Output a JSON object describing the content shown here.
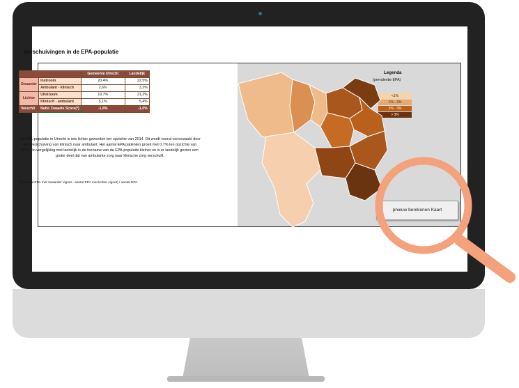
{
  "table": {
    "header_col1": "Gemeente Utrecht",
    "header_col2": "Landelijk",
    "groups": [
      {
        "label": "Zwaarder",
        "rows": [
          {
            "label": "Instroom",
            "v1": "20,4%",
            "v2": "22,5%"
          },
          {
            "label": "Ambulant   - klinisch",
            "v1": "2,6%",
            "v2": "3,2%"
          }
        ]
      },
      {
        "label": "Lichter",
        "rows": [
          {
            "label": "Uitstroom",
            "v1": "19,7%",
            "v2": "21,2%"
          },
          {
            "label": "Klinisch   - ambulant",
            "v1": "5,1%",
            "v2": "5,4%"
          }
        ]
      }
    ],
    "footer": {
      "label": "Verschil",
      "sub": "Netto Zwaarte Score(*)",
      "v1": "-1,8%",
      "v2": "-1,0%"
    }
  },
  "left": {
    "title": "Verschuivingen in de EPA-populatie",
    "paragraph": "De EPA-populatie in Utrecht is iets lichter geworden ten opzichte van 2014. Dit wordt vooral veroorzaakt door een verschuiving van klinisch naar ambulant. Het aantal EPA patiënten groeit met 0,7% ten opzichte van 2014. In vergelijking met landelijk is de toename van de EPA-populaite kleiner en is er landelijk gezien een groter deel dat van ambulante zorg naar klinische zorg verschuift.",
    "footnote": "(*) (aantal EPA met zwaarder vignet - aantal EPA met lichter vignet)  / aantal EPA"
  },
  "legend": {
    "title": "Legenda",
    "subtitle": "(prevalentie EPA)",
    "items": [
      {
        "label": "<1%",
        "color": "#f8d2a8",
        "text_color": "#333333"
      },
      {
        "label": "1% - 2%",
        "color": "#e8a86e",
        "text_color": "#333333"
      },
      {
        "label": "2% - 3%",
        "color": "#b8601c",
        "text_color": "#ffffff"
      },
      {
        "label": "> 3%",
        "color": "#6b3410",
        "text_color": "#ffffff"
      }
    ]
  },
  "recalc_button": "pnieuw berekenen Kaart",
  "colors": {
    "magnifier": "#f3a27c",
    "header": "#8b4a3c"
  },
  "icons": {
    "magnifier": "magnifier-icon"
  }
}
